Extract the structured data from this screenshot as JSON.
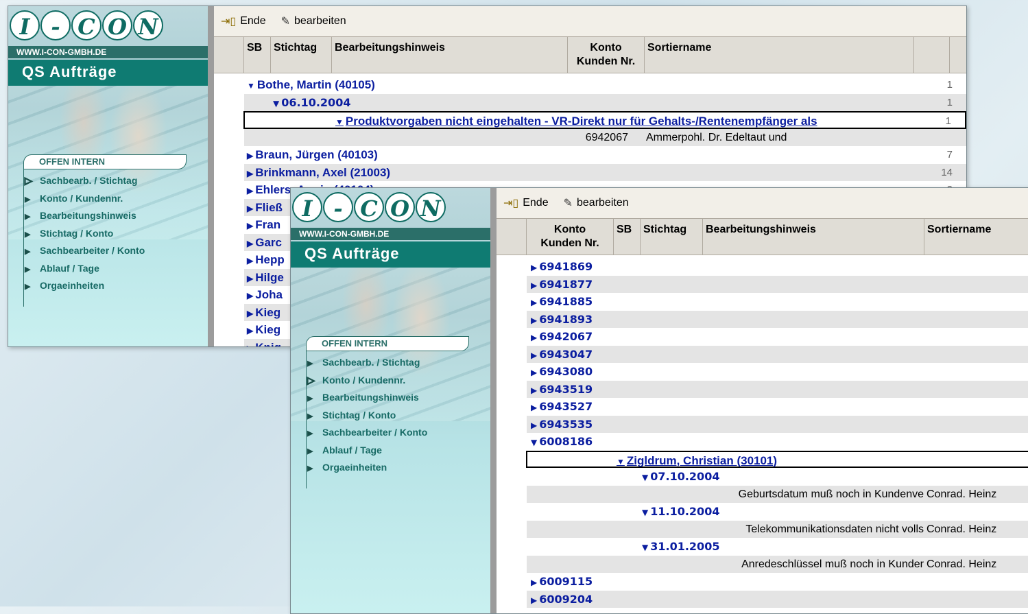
{
  "brand": {
    "letters": [
      "I",
      "-",
      "C",
      "O",
      "N"
    ],
    "url": "WWW.I-CON-GMBH.DE",
    "app_title": "QS Aufträge"
  },
  "menu": {
    "heading": "OFFEN INTERN",
    "items": [
      "Sachbearb. / Stichtag",
      "Konto / Kundennr.",
      "Bearbeitungshinweis",
      "Stichtag / Konto",
      "Sachbearbeiter / Konto",
      "Ablauf / Tage",
      "Orgaeinheiten"
    ]
  },
  "toolbar": {
    "exit_label": "Ende",
    "edit_label": "bearbeiten"
  },
  "window1": {
    "active_menu_index": 0,
    "columns": {
      "sb": "SB",
      "stichtag": "Stichtag",
      "hinweis": "Bearbeitungshinweis",
      "konto_l1": "Konto",
      "konto_l2": "Kunden Nr.",
      "sortiername": "Sortiername"
    },
    "rows": [
      {
        "text": "Bothe, Martin  (40105)",
        "count": "1"
      },
      {
        "text": "06.10.2004",
        "count": "1"
      },
      {
        "text": "Produktvorgaben nicht eingehalten - VR-Direkt nur für Gehalts-/Rentenempfänger als",
        "count": "1"
      },
      {
        "konto": "6942067",
        "name": "Ammerpohl. Dr. Edeltaut und"
      },
      {
        "text": "Braun, Jürgen  (40103)",
        "count": "7"
      },
      {
        "text": "Brinkmann, Axel  (21003)",
        "count": "14"
      },
      {
        "text": "Ehlers, Armin  (40104)",
        "count": "2"
      },
      {
        "text": "Fließ"
      },
      {
        "text": "Fran"
      },
      {
        "text": "Garc"
      },
      {
        "text": "Hepp"
      },
      {
        "text": "Hilge"
      },
      {
        "text": "Joha"
      },
      {
        "text": "Kieg"
      },
      {
        "text": "Kieg"
      },
      {
        "text": "Knig"
      }
    ]
  },
  "window2": {
    "active_menu_index": 1,
    "columns": {
      "konto_l1": "Konto",
      "konto_l2": "Kunden Nr.",
      "sb": "SB",
      "stichtag": "Stichtag",
      "hinweis": "Bearbeitungshinweis",
      "sortiername": "Sortiername"
    },
    "accounts_collapsed": [
      "6941869",
      "6941877",
      "6941885",
      "6941893",
      "6942067",
      "6943047",
      "6943080",
      "6943519",
      "6943527",
      "6943535"
    ],
    "account_open": "6008186",
    "person": "Zigldrum, Christian  (30101)",
    "entries": [
      {
        "date": "07.10.2004",
        "hinweis": "Geburtsdatum muß noch in Kundenve",
        "name": "Conrad. Heinz"
      },
      {
        "date": "11.10.2004",
        "hinweis": "Telekommunikationsdaten nicht volls",
        "name": "Conrad. Heinz"
      },
      {
        "date": "31.01.2005",
        "hinweis": "Anredeschlüssel muß noch in Kunder",
        "name": "Conrad. Heinz"
      }
    ],
    "accounts_after": [
      "6009115",
      "6009204"
    ]
  }
}
